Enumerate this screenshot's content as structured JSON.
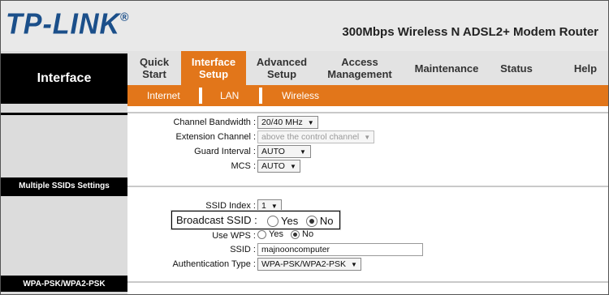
{
  "header": {
    "brand": "TP-LINK",
    "brand_mark": "®",
    "model": "300Mbps Wireless N ADSL2+ Modem Router"
  },
  "sidebar": {
    "section_title": "Interface",
    "labels": [
      "Multiple SSIDs Settings",
      "WPA-PSK/WPA2-PSK"
    ]
  },
  "nav": {
    "items": [
      {
        "label": "Quick Start",
        "active": false
      },
      {
        "label": "Interface Setup",
        "active": true
      },
      {
        "label": "Advanced Setup",
        "active": false
      },
      {
        "label": "Access Management",
        "active": false
      },
      {
        "label": "Maintenance",
        "active": false
      },
      {
        "label": "Status",
        "active": false
      },
      {
        "label": "Help",
        "active": false
      }
    ],
    "subitems": [
      "Internet",
      "LAN",
      "Wireless"
    ]
  },
  "form": {
    "channel_bandwidth": {
      "label": "Channel Bandwidth :",
      "value": "20/40 MHz"
    },
    "extension_channel": {
      "label": "Extension Channel :",
      "value": "above the control channel"
    },
    "guard_interval": {
      "label": "Guard Interval :",
      "value": "AUTO"
    },
    "mcs": {
      "label": "MCS :",
      "value": "AUTO"
    },
    "ssid_index": {
      "label": "SSID Index :",
      "value": "1"
    },
    "broadcast_ssid": {
      "label": "Broadcast SSID :",
      "yes": "Yes",
      "no": "No",
      "selected": "No"
    },
    "use_wps": {
      "label": "Use WPS :",
      "yes": "Yes",
      "no": "No",
      "selected": "No"
    },
    "ssid": {
      "label": "SSID :",
      "value": "majnooncomputer"
    },
    "auth_type": {
      "label": "Authentication Type :",
      "value": "WPA-PSK/WPA2-PSK"
    }
  },
  "colors": {
    "accent": "#e2761a",
    "brand": "#1b4f8a"
  }
}
